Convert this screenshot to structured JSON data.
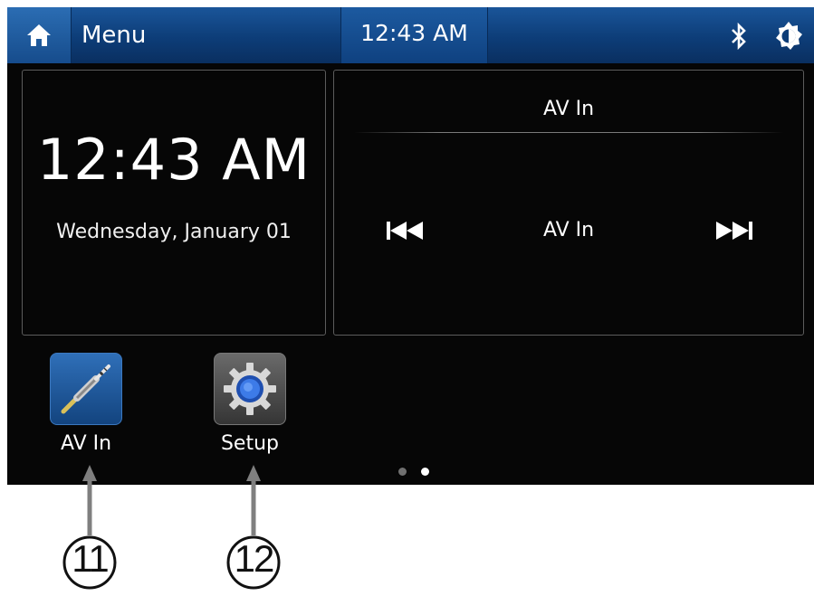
{
  "topbar": {
    "menu_label": "Menu",
    "time": "12:43 AM",
    "icons": [
      "home-icon",
      "bluetooth-icon",
      "brightness-icon"
    ]
  },
  "clock_widget": {
    "time": "12:43 AM",
    "date": "Wednesday, January 01"
  },
  "av_widget": {
    "title": "AV In",
    "source": "AV In",
    "icons": [
      "previous-track-icon",
      "next-track-icon"
    ]
  },
  "apps": [
    {
      "label": "AV In",
      "icon": "audio-jack-icon"
    },
    {
      "label": "Setup",
      "icon": "gear-icon"
    }
  ],
  "pagination": {
    "pages": 2,
    "current_page": 2
  },
  "callouts": [
    "11",
    "12"
  ],
  "colors": {
    "topbar_blue": "#0d3d78",
    "screen_bg": "#060606",
    "panel_border": "#5c5c5c",
    "callout_gray": "#7f7f7f"
  }
}
